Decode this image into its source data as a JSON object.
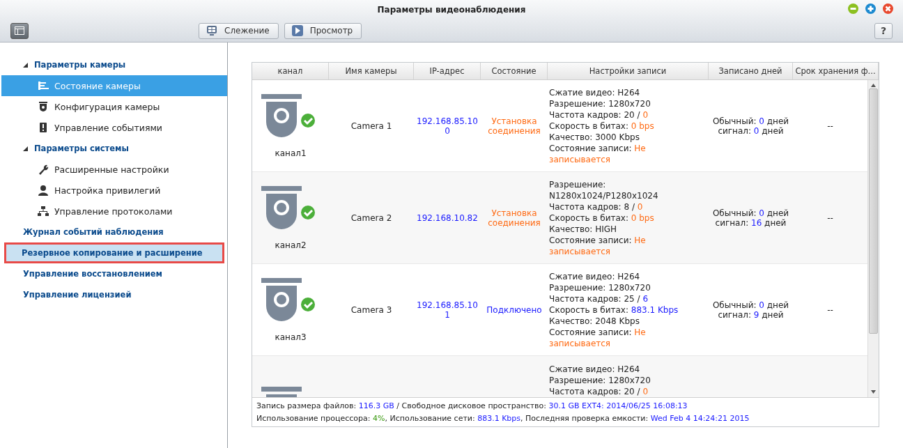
{
  "window": {
    "title": "Параметры видеонаблюдения"
  },
  "toolbar": {
    "buttons": [
      {
        "label": "Слежение",
        "kind": "monitor"
      },
      {
        "label": "Просмотр",
        "kind": "play"
      }
    ],
    "help": "?"
  },
  "sidebar": {
    "items": [
      {
        "label": "Параметры камеры",
        "expanded": true,
        "selected": false,
        "highlighted": false,
        "children": [
          {
            "label": "Состояние камеры",
            "kind": "list",
            "selected": true,
            "highlighted": false
          },
          {
            "label": "Конфигурация камеры",
            "kind": "camera",
            "selected": false,
            "highlighted": false
          },
          {
            "label": "Управление событиями",
            "kind": "alert",
            "selected": false,
            "highlighted": false
          }
        ]
      },
      {
        "label": "Параметры системы",
        "expanded": true,
        "selected": false,
        "highlighted": false,
        "children": [
          {
            "label": "Расширенные настройки",
            "kind": "wrench",
            "selected": false,
            "highlighted": false
          },
          {
            "label": "Настройка привилегий",
            "kind": "user",
            "selected": false,
            "highlighted": false
          },
          {
            "label": "Управление протоколами",
            "kind": "network",
            "selected": false,
            "highlighted": false
          }
        ]
      },
      {
        "label": "Журнал событий наблюдения",
        "selected": false,
        "highlighted": false
      },
      {
        "label": "Резервное копирование и расширение",
        "selected": false,
        "highlighted": true
      },
      {
        "label": "Управление восстановлением",
        "selected": false,
        "highlighted": false
      },
      {
        "label": "Управление лицензией",
        "selected": false,
        "highlighted": false
      }
    ]
  },
  "table": {
    "columns": [
      "канал",
      "Имя камеры",
      "IP-адрес",
      "Состояние",
      "Настройки записи",
      "Записано дней",
      "Срок хранения ф..."
    ],
    "rows": [
      {
        "channel": "канал1",
        "online": true,
        "name": "Camera 1",
        "ip": "192.168.85.100",
        "status": {
          "text": "Установка соединения",
          "kind": "orange"
        },
        "settings": [
          [
            {
              "text": "Сжатие видео: H264",
              "kind": "plain"
            }
          ],
          [
            {
              "text": "Разрешение: 1280x720",
              "kind": "plain"
            }
          ],
          [
            {
              "text": "Частота кадров: 20 / ",
              "kind": "plain"
            },
            {
              "text": "0",
              "kind": "orange"
            }
          ],
          [
            {
              "text": "Скорость в битах: ",
              "kind": "plain"
            },
            {
              "text": "0 bps",
              "kind": "orange"
            }
          ],
          [
            {
              "text": "Качество: 3000 Kbps",
              "kind": "plain"
            }
          ],
          [
            {
              "text": "Состояние записи: ",
              "kind": "plain"
            },
            {
              "text": "Не записывается",
              "kind": "orange"
            }
          ]
        ],
        "days": [
          [
            {
              "text": "Обычный: ",
              "kind": "plain"
            },
            {
              "text": "0",
              "kind": "blue"
            },
            {
              "text": " дней",
              "kind": "plain"
            }
          ],
          [
            {
              "text": "сигнал: ",
              "kind": "plain"
            },
            {
              "text": "0",
              "kind": "blue"
            },
            {
              "text": " дней",
              "kind": "plain"
            }
          ]
        ],
        "retention": "--"
      },
      {
        "channel": "канал2",
        "online": true,
        "name": "Camera 2",
        "ip": "192.168.10.82",
        "status": {
          "text": "Установка соединения",
          "kind": "orange"
        },
        "settings": [
          [
            {
              "text": "Разрешение: N1280x1024/P1280x1024",
              "kind": "plain"
            }
          ],
          [
            {
              "text": "Частота кадров: 8 / ",
              "kind": "plain"
            },
            {
              "text": "0",
              "kind": "orange"
            }
          ],
          [
            {
              "text": "Скорость в битах: ",
              "kind": "plain"
            },
            {
              "text": "0 bps",
              "kind": "orange"
            }
          ],
          [
            {
              "text": "Качество: HIGH",
              "kind": "plain"
            }
          ],
          [
            {
              "text": "Состояние записи: ",
              "kind": "plain"
            },
            {
              "text": "Не записывается",
              "kind": "orange"
            }
          ]
        ],
        "days": [
          [
            {
              "text": "Обычный: ",
              "kind": "plain"
            },
            {
              "text": "0",
              "kind": "blue"
            },
            {
              "text": " дней",
              "kind": "plain"
            }
          ],
          [
            {
              "text": "сигнал: ",
              "kind": "plain"
            },
            {
              "text": "16",
              "kind": "blue"
            },
            {
              "text": " дней",
              "kind": "plain"
            }
          ]
        ],
        "retention": "--"
      },
      {
        "channel": "канал3",
        "online": true,
        "name": "Camera 3",
        "ip": "192.168.85.101",
        "status": {
          "text": "Подключено",
          "kind": "blue"
        },
        "settings": [
          [
            {
              "text": "Сжатие видео: H264",
              "kind": "plain"
            }
          ],
          [
            {
              "text": "Разрешение: 1280x720",
              "kind": "plain"
            }
          ],
          [
            {
              "text": "Частота кадров: 25 / ",
              "kind": "plain"
            },
            {
              "text": "6",
              "kind": "blue"
            }
          ],
          [
            {
              "text": "Скорость в битах: ",
              "kind": "plain"
            },
            {
              "text": "883.1 Kbps",
              "kind": "blue"
            }
          ],
          [
            {
              "text": "Качество: 2048 Kbps",
              "kind": "plain"
            }
          ],
          [
            {
              "text": "Состояние записи: ",
              "kind": "plain"
            },
            {
              "text": "Не записывается",
              "kind": "orange"
            }
          ]
        ],
        "days": [
          [
            {
              "text": "Обычный: ",
              "kind": "plain"
            },
            {
              "text": "0",
              "kind": "blue"
            },
            {
              "text": " дней",
              "kind": "plain"
            }
          ],
          [
            {
              "text": "сигнал: ",
              "kind": "plain"
            },
            {
              "text": "9",
              "kind": "blue"
            },
            {
              "text": " дней",
              "kind": "plain"
            }
          ]
        ],
        "retention": "--"
      },
      {
        "camera_visible": true,
        "settings": [
          [
            {
              "text": "Сжатие видео: H264",
              "kind": "plain"
            }
          ],
          [
            {
              "text": "Разрешение: 1280x720",
              "kind": "plain"
            }
          ],
          [
            {
              "text": "Частота кадров: 20 / ",
              "kind": "plain"
            },
            {
              "text": "0",
              "kind": "orange"
            }
          ]
        ]
      }
    ]
  },
  "footer": [
    [
      {
        "text": "Запись размера файлов: ",
        "kind": "plain"
      },
      {
        "text": "116.3 GB",
        "kind": "blue"
      },
      {
        "text": " / Свободное дисковое пространство: ",
        "kind": "plain"
      },
      {
        "text": "30.1 GB EXT4: 2014/06/25 16:08:13",
        "kind": "blue"
      }
    ],
    [
      {
        "text": "Использование процессора: ",
        "kind": "plain"
      },
      {
        "text": "4%",
        "kind": "green"
      },
      {
        "text": ", Использование сети: ",
        "kind": "plain"
      },
      {
        "text": "883.1 Kbps",
        "kind": "blue"
      },
      {
        "text": ", Последняя проверка емкости: ",
        "kind": "plain"
      },
      {
        "text": "Wed Feb 4 14:24:21 2015",
        "kind": "blue"
      }
    ]
  ]
}
